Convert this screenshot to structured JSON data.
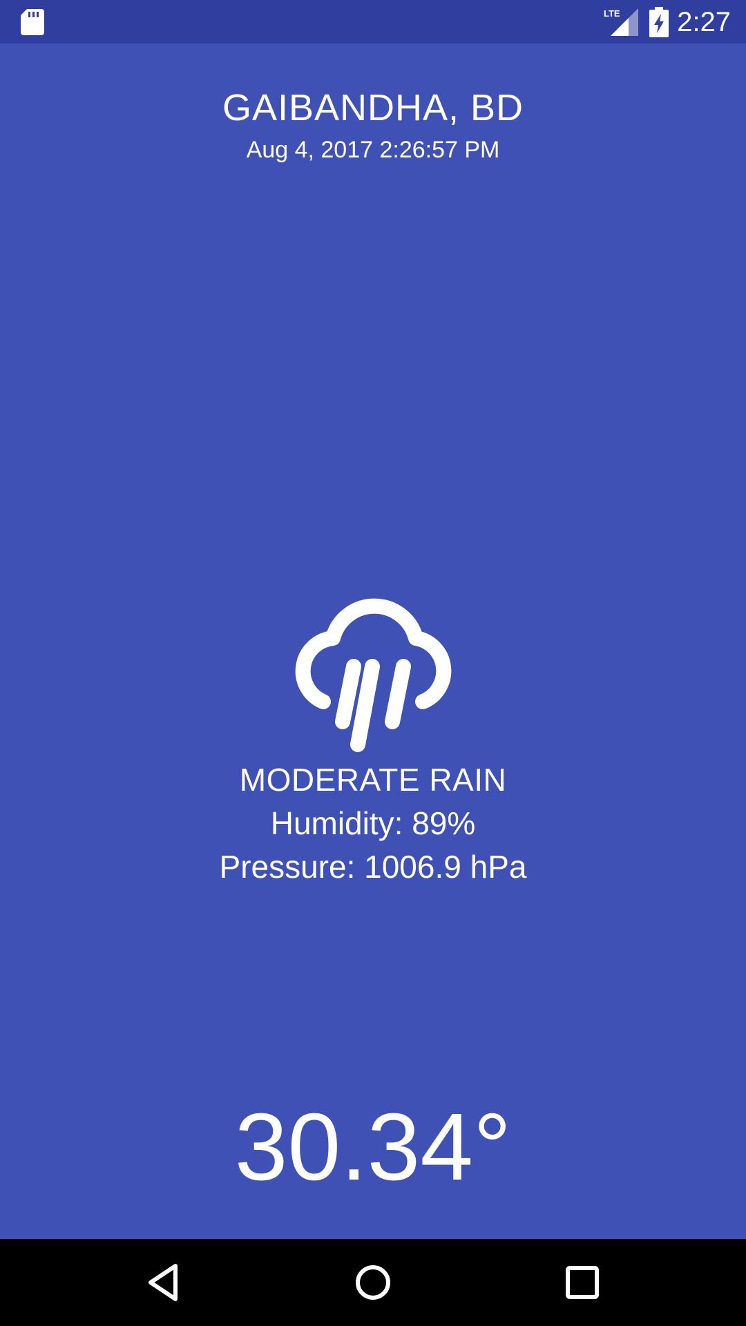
{
  "status_bar": {
    "time": "2:27",
    "network_label": "LTE",
    "icons": [
      "sd-card-icon",
      "lte-signal-icon",
      "battery-charging-icon"
    ]
  },
  "weather": {
    "location": "GAIBANDHA, BD",
    "updated": "Aug 4, 2017 2:26:57 PM",
    "condition": "MODERATE RAIN",
    "condition_icon": "cloud-rain-icon",
    "humidity": "Humidity: 89%",
    "pressure": "Pressure: 1006.9 hPa",
    "temperature": "30.34°"
  },
  "nav_bar": {
    "buttons": [
      "back-icon",
      "home-icon",
      "recents-icon"
    ]
  },
  "colors": {
    "background": "#3F51B5",
    "status_bar": "#303F9F",
    "text": "#FFFFFF",
    "nav_bar": "#000000"
  }
}
